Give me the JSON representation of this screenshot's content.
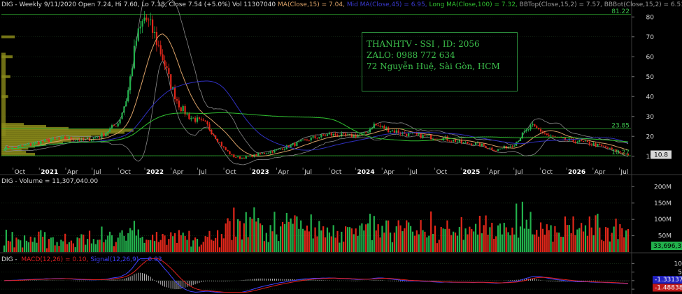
{
  "header": {
    "symbol": "DIG - Weekly 9/11/2020",
    "ohlc": "Open 7.24, Hi 7.60, Lo 7.18, Close 7.54 (+5.0%) Vol 11307040",
    "ma15": "MA(Close,15) = 7.04,",
    "ma45": "Mid MA(Close,45) = 6.95,",
    "ma100": "Long MA(Close,100) = 7.32,",
    "bbtop": "BBTop(Close,15,2) = 7.57,",
    "bbbot": "BBBot(Close,15,2) = 6.51"
  },
  "watermark": {
    "line1": "THANHTV - SSI , ID: 2056",
    "line2": "ZALO: 0988 772 634",
    "line3": "72 Nguyễn Huệ, Sài Gòn, HCM"
  },
  "price_panel": {
    "right_axis": [
      "80",
      "70",
      "60",
      "50",
      "40",
      "30",
      "20",
      "10"
    ],
    "hline_labels": [
      "81.22",
      "23.85",
      "10.27"
    ],
    "last_price": "10.8",
    "time_axis": [
      "Oct",
      "2021",
      "Apr",
      "Jul",
      "Oct",
      "2022",
      "Apr",
      "Jul",
      "Oct",
      "2023",
      "Apr",
      "Jul",
      "Oct",
      "2024",
      "Apr",
      "Jul",
      "Oct",
      "2025",
      "Apr",
      "Jul",
      "Oct",
      "2026",
      "Apr",
      "Jul"
    ]
  },
  "volume_panel": {
    "title": "DIG - Volume = 11,307,040.00",
    "axis": [
      "200M",
      "150M",
      "100M",
      "50M"
    ],
    "last_value": "33,696,3..."
  },
  "macd_panel": {
    "title_prefix": "DIG - ",
    "macd_label": "MACD(12,26) = 0.10,",
    "signal_label": "Signal(12,26,9) = 0.03",
    "axis": [
      "10",
      "5",
      "0",
      "-5"
    ],
    "macd_last": "-1.33137",
    "signal_last": "-1.48838"
  },
  "colors": {
    "up": "#22b14c",
    "down": "#e0271a",
    "ma_short": "#d9a066",
    "ma_mid": "#3030c0",
    "ma_long": "#30c030",
    "bb": "#8a8a8a",
    "macd": "#4040ff",
    "signal": "#e02020",
    "text": "#d8d8d8",
    "grid": "#1e3a1e"
  },
  "chart_data": [
    {
      "type": "candlestick",
      "title": "DIG - Weekly",
      "y_scale": "linear",
      "ylim": [
        5,
        85
      ],
      "x_range": [
        "2020-09",
        "2026-08"
      ],
      "ohlc_last": {
        "open": 7.24,
        "high": 7.6,
        "low": 7.18,
        "close": 7.54
      },
      "horizontal_lines": [
        81.22,
        23.85,
        10.27
      ],
      "weekly_close_approx": {
        "x": [
          "2020-10",
          "2020-12",
          "2021-02",
          "2021-04",
          "2021-06",
          "2021-08",
          "2021-10",
          "2021-11",
          "2021-12",
          "2022-01",
          "2022-02",
          "2022-03",
          "2022-04",
          "2022-05",
          "2022-06",
          "2022-07",
          "2022-08",
          "2022-09",
          "2022-10",
          "2022-11",
          "2022-12",
          "2023-02",
          "2023-04",
          "2023-06",
          "2023-08",
          "2023-10",
          "2023-12",
          "2024-02",
          "2024-03",
          "2024-05",
          "2024-07",
          "2024-09",
          "2024-11",
          "2025-01",
          "2025-03",
          "2025-05",
          "2025-07",
          "2025-08",
          "2025-09",
          "2025-10",
          "2025-11",
          "2026-01",
          "2026-03",
          "2026-05",
          "2026-07",
          "2026-08"
        ],
        "y": [
          14,
          16,
          18,
          19,
          18,
          20,
          27,
          40,
          68,
          80,
          72,
          60,
          45,
          35,
          30,
          28,
          26,
          20,
          14,
          10,
          9,
          11,
          13,
          16,
          19,
          21,
          20,
          21,
          26,
          23,
          21,
          20,
          19,
          17,
          16,
          13,
          16,
          21,
          25,
          23,
          20,
          18,
          17,
          15,
          12,
          10.8
        ]
      },
      "series": [
        {
          "name": "MA(Close,15)",
          "value": 7.04
        },
        {
          "name": "Mid MA(Close,45)",
          "value": 6.95
        },
        {
          "name": "Long MA(Close,100)",
          "value": 7.32
        },
        {
          "name": "BBTop(Close,15,2)",
          "value": 7.57
        },
        {
          "name": "BBBot(Close,15,2)",
          "value": 6.51
        }
      ]
    },
    {
      "type": "bar",
      "title": "DIG - Volume = 11,307,040.00",
      "ylim": [
        0,
        220000000
      ],
      "last_value": 11307040
    },
    {
      "type": "line",
      "title": "DIG - MACD(12,26) = 0.10, Signal(12,26,9) = 0.03",
      "ylim": [
        -7,
        13
      ],
      "series": [
        {
          "name": "MACD(12,26)",
          "value": 0.1
        },
        {
          "name": "Signal(12,26,9)",
          "value": 0.03
        }
      ]
    }
  ]
}
